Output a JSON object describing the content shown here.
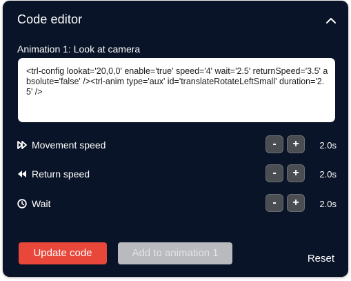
{
  "header": {
    "title": "Code editor",
    "collapse_icon": "chevron-up-icon"
  },
  "animation": {
    "label": "Animation 1: Look at camera",
    "code": "<trl-config lookat='20,0,0' enable='true' speed='4' wait='2.5' returnSpeed='3.5' absolute='false' /><trl-anim type='aux' id='translateRotateLeftSmall' duration='2.5' />"
  },
  "controls": {
    "movement_speed": {
      "label": "Movement speed",
      "icon": "fast-forward-icon",
      "value": "2.0s",
      "minus": "-",
      "plus": "+"
    },
    "return_speed": {
      "label": "Return speed",
      "icon": "rewind-icon",
      "value": "2.0s",
      "minus": "-",
      "plus": "+"
    },
    "wait": {
      "label": "Wait",
      "icon": "clock-icon",
      "value": "2.0s",
      "minus": "-",
      "plus": "+"
    }
  },
  "footer": {
    "update_label": "Update code",
    "add_label": "Add to animation 1",
    "reset_label": "Reset"
  },
  "colors": {
    "panel_background": "#0a1428",
    "primary_button": "#e8473a",
    "disabled_button": "#b8babd",
    "stepper_button": "#4a4d52"
  }
}
